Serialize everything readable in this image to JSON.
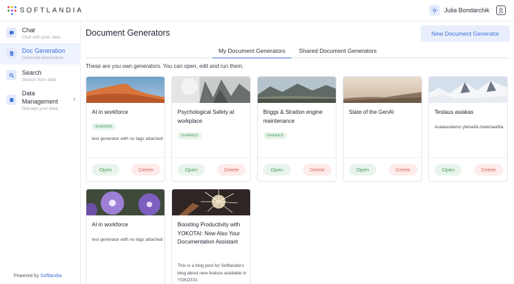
{
  "app": {
    "logo_text": "SOFTLANDIA",
    "user_name": "Julia Bondarchik"
  },
  "sidebar": {
    "items": [
      {
        "label": "Chat",
        "sub": "Chat with your data",
        "icon": "chat-icon"
      },
      {
        "label": "Doc Generation",
        "sub": "Generate documents",
        "icon": "document-icon"
      },
      {
        "label": "Search",
        "sub": "Search from data",
        "icon": "search-icon"
      },
      {
        "label": "Data Management",
        "sub": "Manage your data",
        "icon": "database-icon"
      }
    ],
    "powered_prefix": "Powered by",
    "powered_link": "Softlandia"
  },
  "main": {
    "title": "Document Generators",
    "new_button": "New Document Generator",
    "tabs": [
      {
        "label": "My Document Generators",
        "active": true
      },
      {
        "label": "Shared Document Generators",
        "active": false
      }
    ],
    "intro": "These are you own generators. You can open, edit and run them."
  },
  "cards": [
    {
      "title": "AI in workforce",
      "shared": true,
      "desc": "test generator with no tags attached"
    },
    {
      "title": "Psychological Safety at workplace",
      "shared": true,
      "desc": ""
    },
    {
      "title": "Briggs & Stratton engine maintenance",
      "shared": true,
      "desc": ""
    },
    {
      "title": "State of the GenAI",
      "shared": false,
      "desc": ""
    },
    {
      "title": "Testaus asiakas",
      "shared": false,
      "desc": "Asiakasdemo yleisellä materiaalilla"
    },
    {
      "title": "AI in workforce",
      "shared": false,
      "desc": "test generator with no tags attached"
    },
    {
      "title": "Boosting Productivity with YOKOTAI: Now Also Your Documentation Assistant",
      "shared": false,
      "desc": "This is a blog post for Softlandia's blog about new feature available in YOKOTAI."
    }
  ],
  "labels": {
    "shared_badge": "SHARED",
    "open": "Open",
    "delete": "Delete"
  },
  "colors": {
    "accent": "#3d6fd9",
    "open_green": "#4a9a5d",
    "delete_red": "#e06a62"
  }
}
